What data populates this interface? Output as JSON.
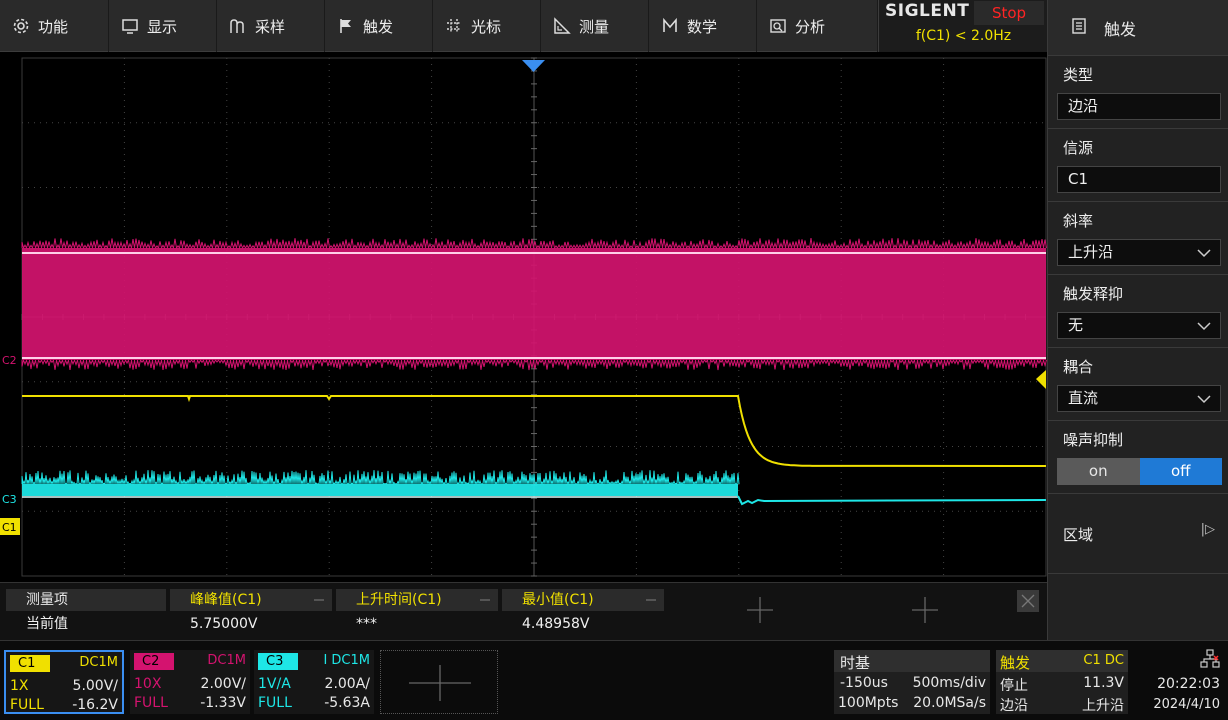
{
  "menu": {
    "items": [
      {
        "label": "功能",
        "icon": "gear-icon"
      },
      {
        "label": "显示",
        "icon": "monitor-icon"
      },
      {
        "label": "采样",
        "icon": "sample-icon"
      },
      {
        "label": "触发",
        "icon": "flag-icon"
      },
      {
        "label": "光标",
        "icon": "cursor-grid-icon"
      },
      {
        "label": "测量",
        "icon": "ruler-icon"
      },
      {
        "label": "数学",
        "icon": "math-icon"
      },
      {
        "label": "分析",
        "icon": "analysis-icon"
      }
    ]
  },
  "brand": {
    "logo": "SIGLENT",
    "run_status": "Stop",
    "trigger_freq": "f(C1) < 2.0Hz"
  },
  "trigger_panel": {
    "title": "触发",
    "type_label": "类型",
    "type_value": "边沿",
    "source_label": "信源",
    "source_value": "C1",
    "slope_label": "斜率",
    "slope_value": "上升沿",
    "holdoff_label": "触发释抑",
    "holdoff_value": "无",
    "coupling_label": "耦合",
    "coupling_value": "直流",
    "noise_label": "噪声抑制",
    "noise_on": "on",
    "noise_off": "off",
    "noise_state": "off",
    "zone_label": "区域"
  },
  "waveform": {
    "ch1_color": "#f0e000",
    "ch2_color": "#d4136f",
    "ch3_color": "#1ee6e6",
    "ch1_marker": "C1",
    "ch2_marker": "C2",
    "ch3_marker": "C3"
  },
  "measure": {
    "row_header": "测量项",
    "row_value": "当前值",
    "items": [
      {
        "name": "峰峰值(C1)",
        "value": "5.75000V"
      },
      {
        "name": "上升时间(C1)",
        "value": "***"
      },
      {
        "name": "最小值(C1)",
        "value": "4.48958V"
      }
    ]
  },
  "channels": [
    {
      "name": "C1",
      "coupling": "DC1M",
      "probe": "1X",
      "scale": "5.00V/",
      "bw": "FULL",
      "offset": "-16.2V",
      "color": "#f0e000"
    },
    {
      "name": "C2",
      "coupling": "DC1M",
      "probe": "10X",
      "scale": "2.00V/",
      "bw": "FULL",
      "offset": "-1.33V",
      "color": "#d4136f"
    },
    {
      "name": "C3",
      "coupling": "I DC1M",
      "probe": "1V/A",
      "scale": "2.00A/",
      "bw": "FULL",
      "offset": "-5.63A",
      "color": "#1ee6e6"
    }
  ],
  "timebase": {
    "title": "时基",
    "delay": "-150us",
    "scale": "500ms/div",
    "memory": "100Mpts",
    "rate": "20.0MSa/s"
  },
  "trigger_status": {
    "title": "触发",
    "source": "C1 DC",
    "mode": "停止",
    "level": "11.3V",
    "type": "边沿",
    "slope": "上升沿"
  },
  "clock": {
    "time": "20:22:03",
    "date": "2024/4/10"
  }
}
